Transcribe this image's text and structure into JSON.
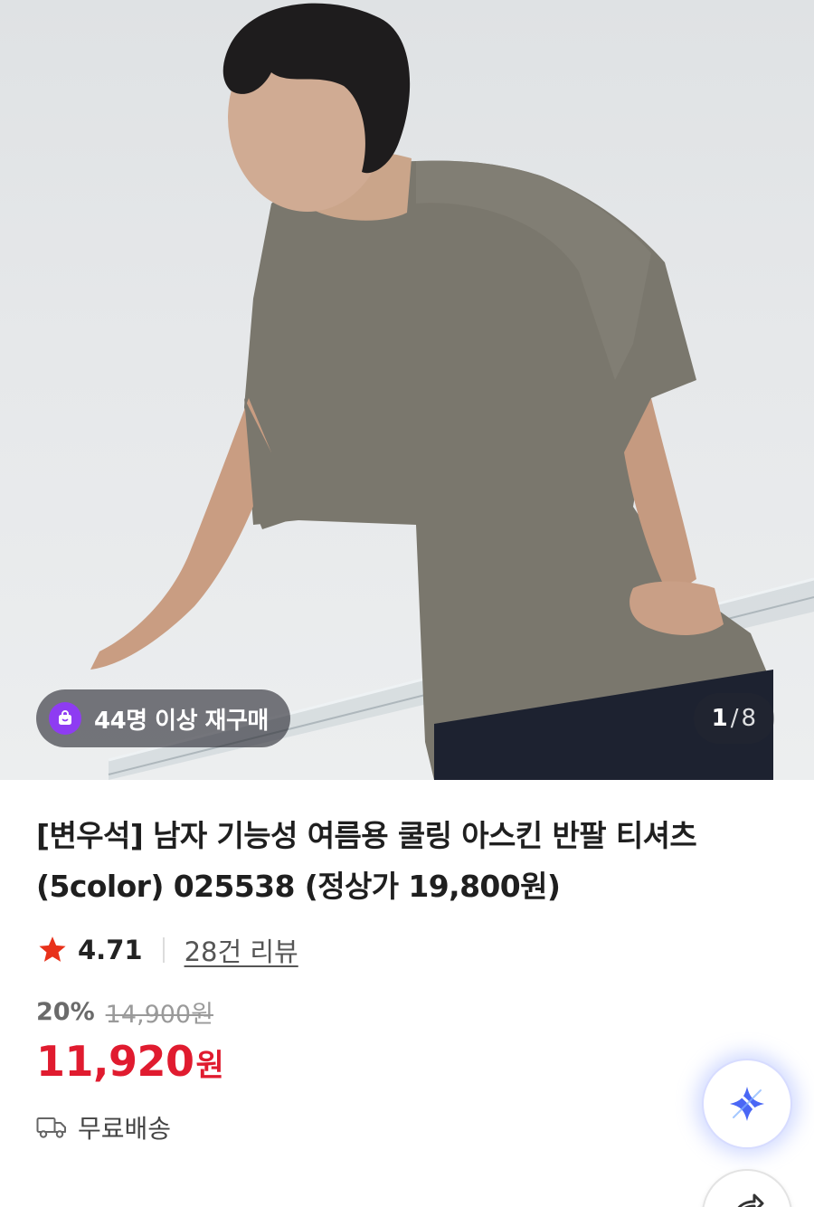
{
  "hero": {
    "repurchase_badge": "44명 이상 재구매",
    "counter_current": "1",
    "counter_separator": "/",
    "counter_total": "8"
  },
  "product": {
    "title": "[변우석] 남자 기능성 여름용 쿨링 아스킨 반팔 티셔츠 (5color) 025538 (정상가 19,800원)",
    "rating": "4.71",
    "review_link": "28건 리뷰",
    "discount_rate": "20%",
    "original_price": "14,900원",
    "sale_price": "11,920",
    "price_unit": "원",
    "shipping": "무료배송"
  },
  "icons": {
    "badge": "shopping-bag-icon",
    "rating": "star-icon",
    "shipping": "truck-icon",
    "ai_button": "sparkle-icon",
    "share_button": "share-icon"
  },
  "colors": {
    "accent_purple": "#8e3cf2",
    "sale_red": "#e01b2f",
    "star_red": "#e8311a",
    "ai_blue": "#4a67f5"
  }
}
